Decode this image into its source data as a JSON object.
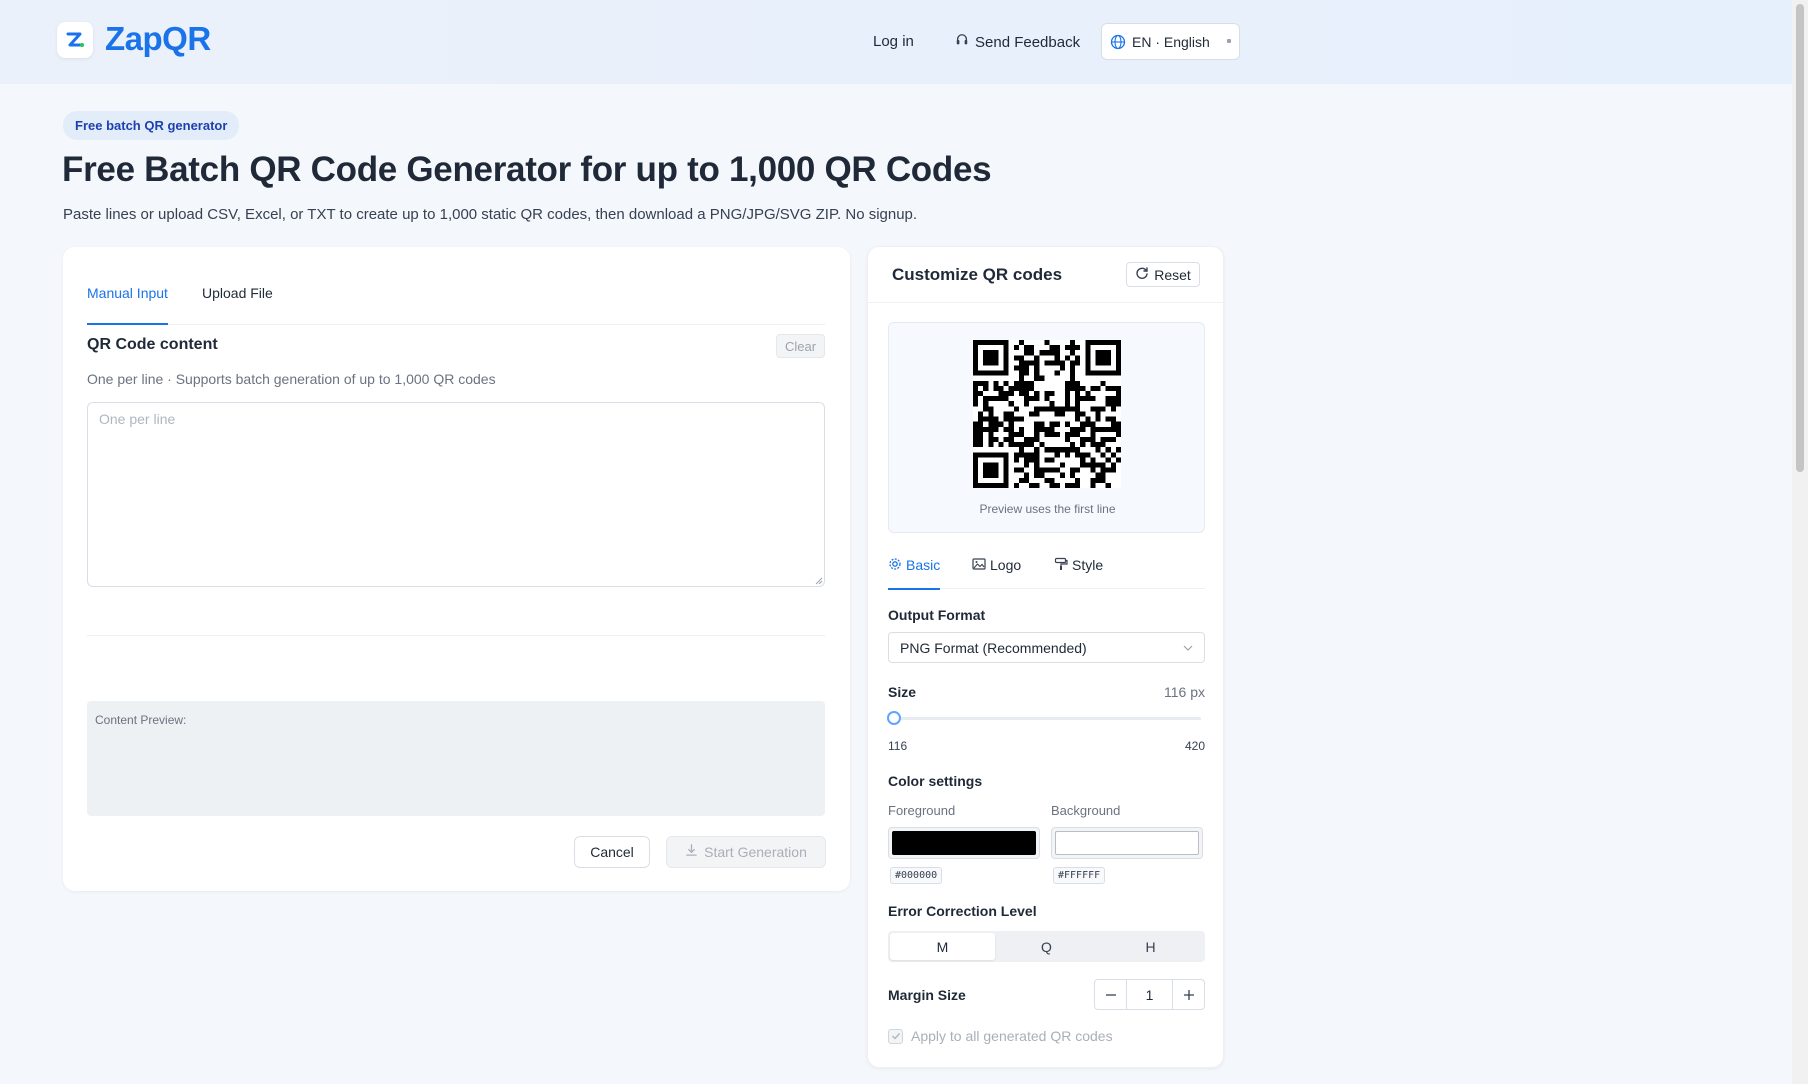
{
  "header": {
    "brand": "ZapQR",
    "nav": {
      "login": "Log in",
      "feedback": "Send Feedback",
      "language": "EN · English"
    }
  },
  "hero": {
    "pill": "Free batch QR generator",
    "title": "Free Batch QR Code Generator for up to 1,000 QR Codes",
    "subtitle": "Paste lines or upload CSV, Excel, or TXT to create up to 1,000 static QR codes, then download a PNG/JPG/SVG ZIP. No signup."
  },
  "input_card": {
    "tabs": [
      "Manual Input",
      "Upload File"
    ],
    "active_tab": "Manual Input",
    "content_title": "QR Code content",
    "clear_label": "Clear",
    "hint": "One per line · Supports batch generation of up to 1,000 QR codes",
    "textarea_value": "",
    "textarea_placeholder": "One per line",
    "content_preview_label": "Content Preview:",
    "cancel_label": "Cancel",
    "start_label": "Start Generation"
  },
  "customize": {
    "title": "Customize QR codes",
    "reset_label": "Reset",
    "preview_note": "Preview uses the first line",
    "tabs": [
      {
        "label": "Basic",
        "icon": "gear-icon"
      },
      {
        "label": "Logo",
        "icon": "image-icon"
      },
      {
        "label": "Style",
        "icon": "paint-roller-icon"
      }
    ],
    "active_tab": "Basic",
    "output_format_label": "Output Format",
    "output_format_value": "PNG Format (Recommended)",
    "size_label": "Size",
    "size_value": "116 px",
    "size_min": "116",
    "size_max": "420",
    "size_current": 116,
    "color_label": "Color settings",
    "foreground_label": "Foreground",
    "background_label": "Background",
    "foreground": "#000000",
    "background": "#FFFFFF",
    "ecl_label": "Error Correction Level",
    "ecl_options": [
      "M",
      "Q",
      "H"
    ],
    "ecl_selected": "M",
    "margin_label": "Margin Size",
    "margin_value": "1",
    "apply_label": "Apply to all generated QR codes",
    "apply_checked": true
  },
  "colors": {
    "accent": "#1a73e8",
    "brand": "#1a73e8"
  }
}
